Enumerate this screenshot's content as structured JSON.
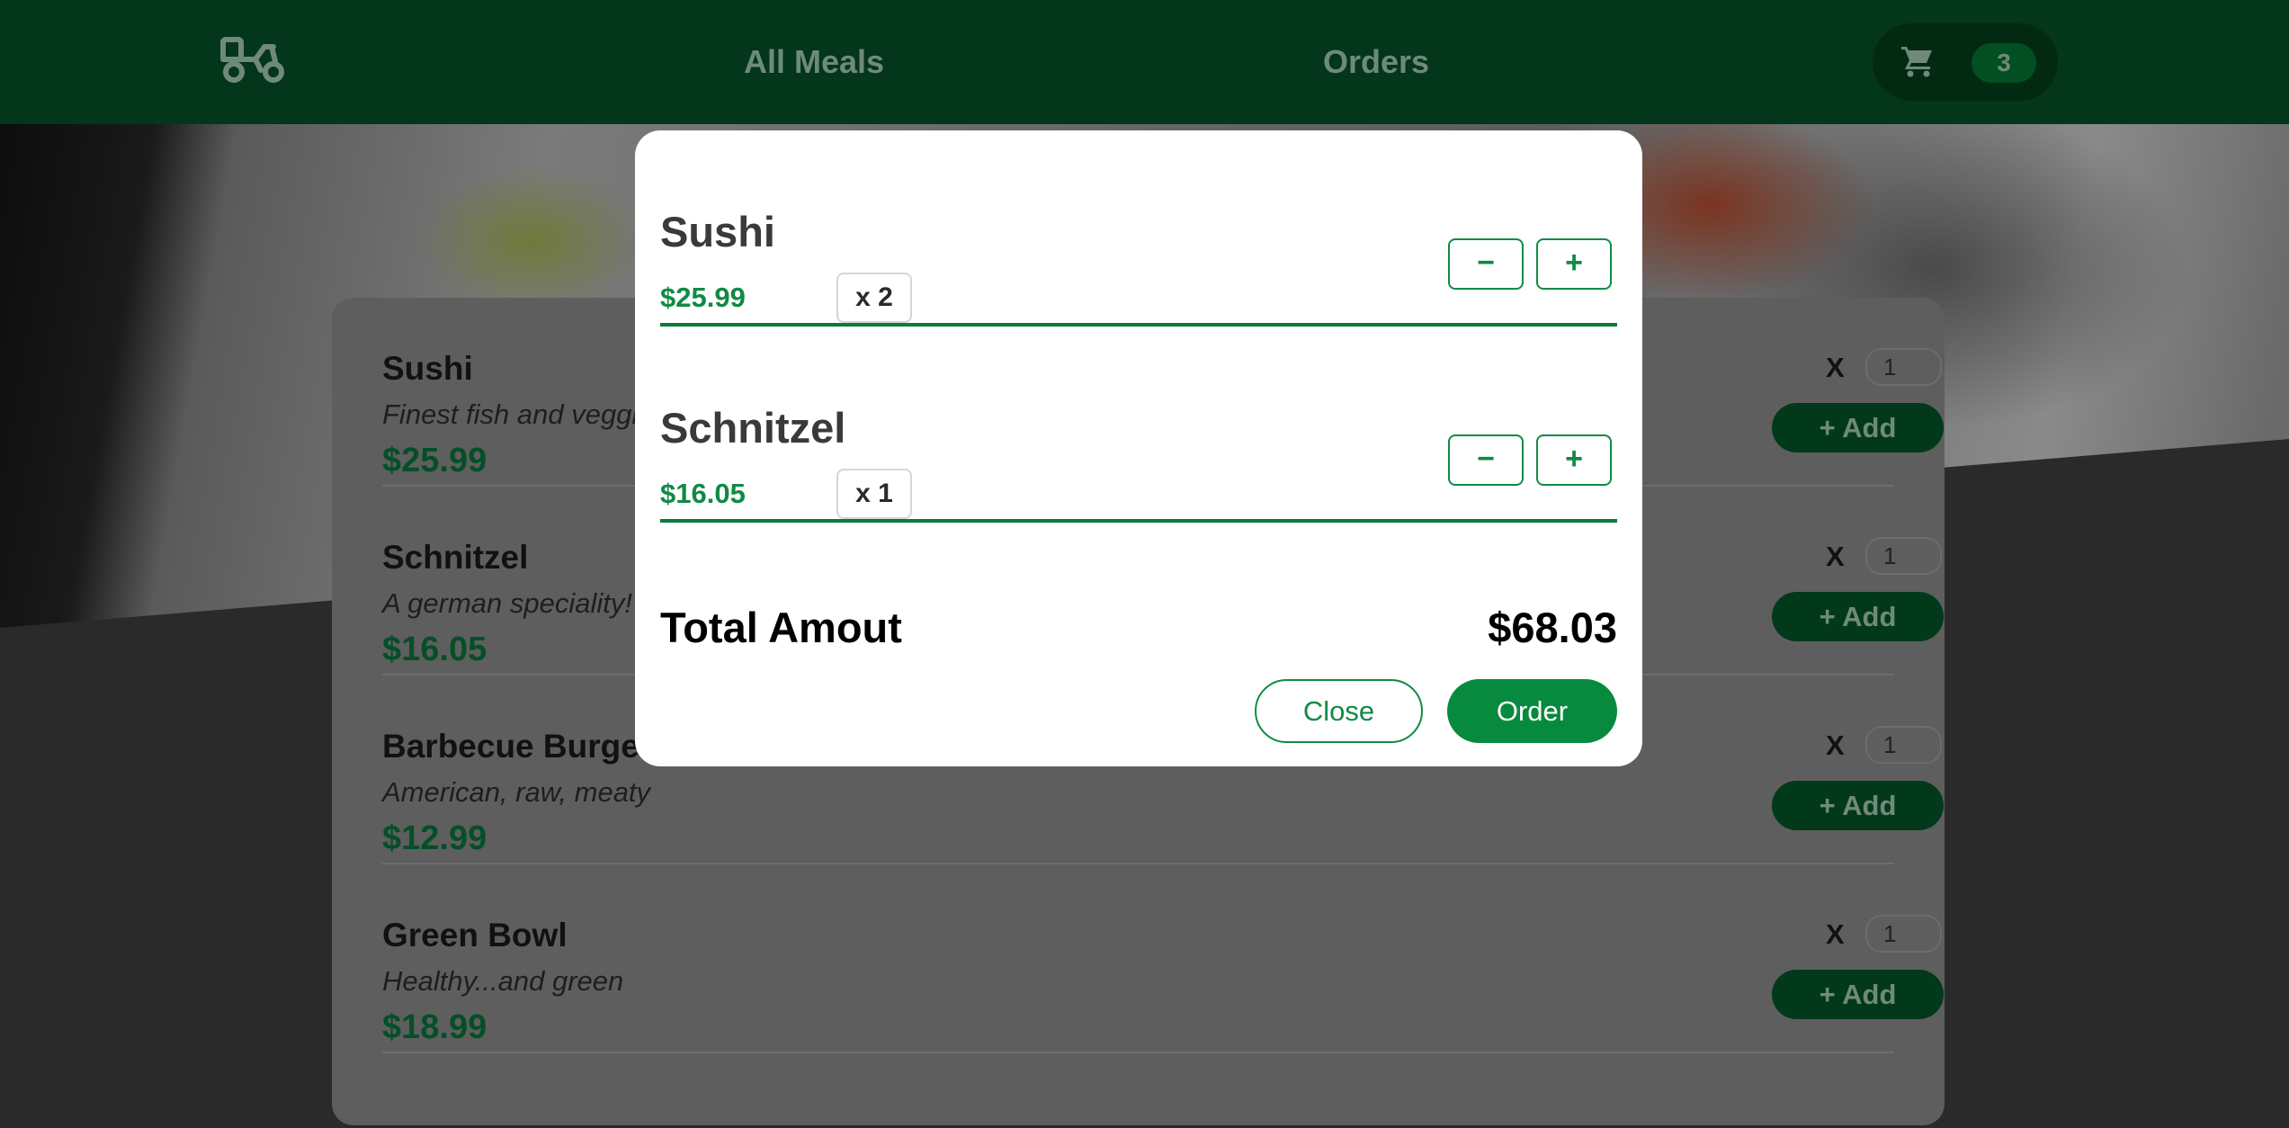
{
  "header": {
    "logo_icon": "scooter-icon",
    "nav": [
      {
        "label": "All Meals"
      },
      {
        "label": "Orders"
      }
    ],
    "cart": {
      "icon": "cart-icon",
      "count": "3"
    }
  },
  "menu": {
    "items": [
      {
        "name": "Sushi",
        "description": "Finest fish and veggies",
        "price": "$25.99",
        "qty_label": "X",
        "qty_value": "1",
        "add_label": "+ Add"
      },
      {
        "name": "Schnitzel",
        "description": "A german speciality!",
        "price": "$16.05",
        "qty_label": "X",
        "qty_value": "1",
        "add_label": "+ Add"
      },
      {
        "name": "Barbecue Burger",
        "description": "American, raw, meaty",
        "price": "$12.99",
        "qty_label": "X",
        "qty_value": "1",
        "add_label": "+ Add"
      },
      {
        "name": "Green Bowl",
        "description": "Healthy...and green",
        "price": "$18.99",
        "qty_label": "X",
        "qty_value": "1",
        "add_label": "+ Add"
      }
    ]
  },
  "cart_modal": {
    "items": [
      {
        "name": "Sushi",
        "price": "$25.99",
        "qty": "x 2",
        "minus": "−",
        "plus": "+"
      },
      {
        "name": "Schnitzel",
        "price": "$16.05",
        "qty": "x 1",
        "minus": "−",
        "plus": "+"
      }
    ],
    "total_label": "Total Amout",
    "total_amount": "$68.03",
    "close_label": "Close",
    "order_label": "Order"
  },
  "colors": {
    "header_bg": "#03361a",
    "accent_green": "#118a44",
    "order_button": "#078a3e"
  }
}
